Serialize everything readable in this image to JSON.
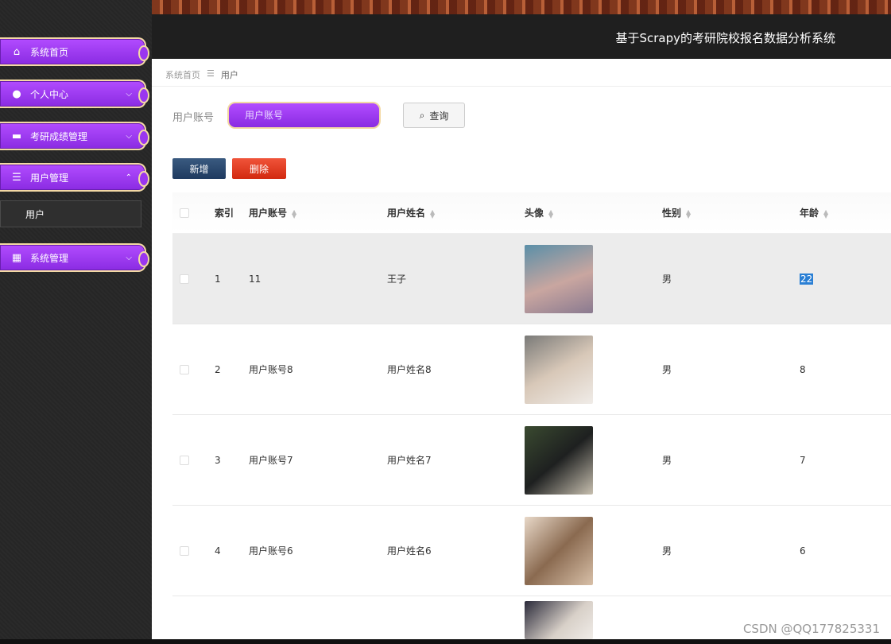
{
  "header": {
    "title": "基于Scrapy的考研院校报名数据分析系统"
  },
  "sidebar": {
    "items": [
      {
        "label": "系统首页",
        "icon": "home-icon",
        "chevron": ""
      },
      {
        "label": "个人中心",
        "icon": "user-icon",
        "chevron": "⌵"
      },
      {
        "label": "考研成绩管理",
        "icon": "briefcase-icon",
        "chevron": "⌵"
      },
      {
        "label": "用户管理",
        "icon": "list-icon",
        "chevron": "⌃"
      },
      {
        "label": "系统管理",
        "icon": "grid-icon",
        "chevron": "⌵"
      }
    ],
    "sub_item": "用户"
  },
  "breadcrumb": {
    "home": "系统首页",
    "sep": "☰",
    "current": "用户"
  },
  "search": {
    "label": "用户账号",
    "placeholder": "用户账号",
    "button": "查询"
  },
  "actions": {
    "add": "新增",
    "delete": "删除"
  },
  "table": {
    "headers": {
      "index": "索引",
      "account": "用户账号",
      "name": "用户姓名",
      "avatar": "头像",
      "sex": "性别",
      "age": "年龄"
    },
    "rows": [
      {
        "index": "1",
        "account": "11",
        "name": "王子",
        "sex": "男",
        "age": "22"
      },
      {
        "index": "2",
        "account": "用户账号8",
        "name": "用户姓名8",
        "sex": "男",
        "age": "8"
      },
      {
        "index": "3",
        "account": "用户账号7",
        "name": "用户姓名7",
        "sex": "男",
        "age": "7"
      },
      {
        "index": "4",
        "account": "用户账号6",
        "name": "用户姓名6",
        "sex": "男",
        "age": "6"
      }
    ]
  },
  "watermark": "CSDN @QQ177825331"
}
